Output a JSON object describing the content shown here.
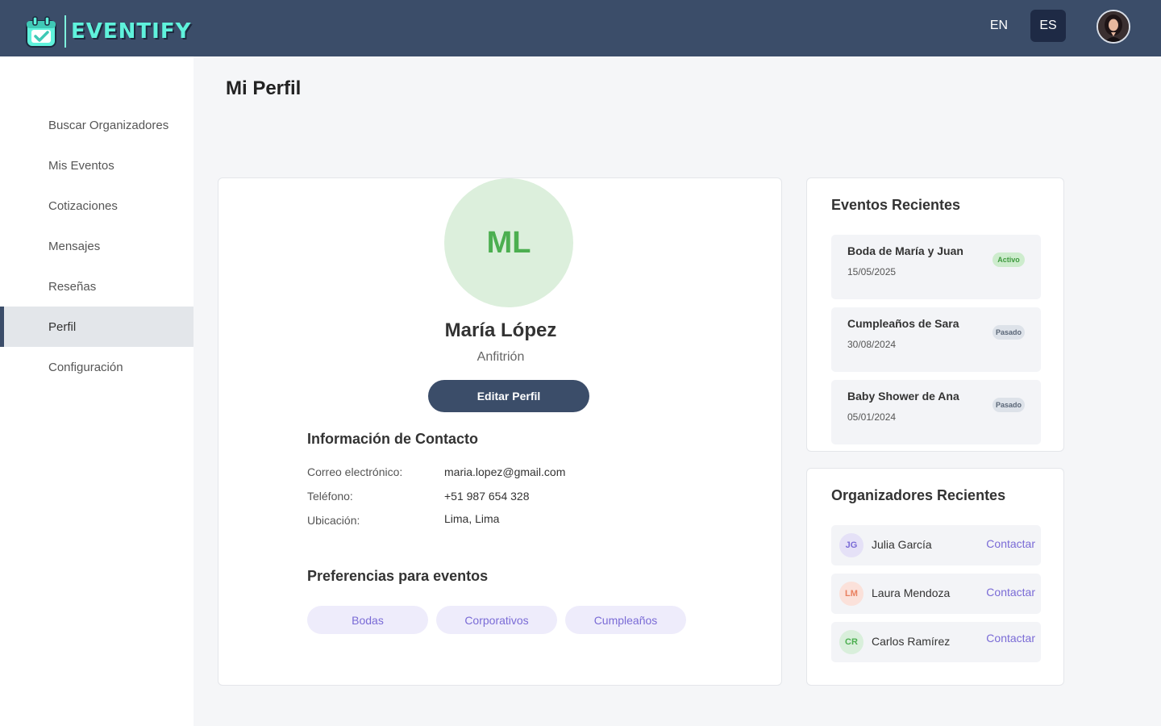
{
  "header": {
    "logo_text": "EVENTIFY",
    "languages": [
      {
        "label": "EN",
        "active": false
      },
      {
        "label": "ES",
        "active": true
      }
    ]
  },
  "sidebar": {
    "items": [
      {
        "label": "Buscar Organizadores",
        "active": false
      },
      {
        "label": "Mis Eventos",
        "active": false
      },
      {
        "label": "Cotizaciones",
        "active": false
      },
      {
        "label": "Mensajes",
        "active": false
      },
      {
        "label": "Reseñas",
        "active": false
      },
      {
        "label": "Perfil",
        "active": true
      },
      {
        "label": "Configuración",
        "active": false
      }
    ]
  },
  "page_title": "Mi Perfil",
  "profile": {
    "initials": "ML",
    "name": "María López",
    "role": "Anfitrión",
    "edit_label": "Editar Perfil",
    "contact_title": "Información de Contacto",
    "contact": {
      "email_label": "Correo electrónico:",
      "email": "maria.lopez@gmail.com",
      "phone_label": "Teléfono:",
      "phone": "+51 987 654 328",
      "location_label": "Ubicación:",
      "location": "Lima, Lima"
    },
    "preferences_title": "Preferencias para eventos",
    "preferences": [
      "Bodas",
      "Corporativos",
      "Cumpleaños"
    ]
  },
  "recent_events": {
    "title": "Eventos Recientes",
    "items": [
      {
        "name": "Boda de María y Juan",
        "date": "15/05/2025",
        "status": "Activo"
      },
      {
        "name": "Cumpleaños de Sara",
        "date": "30/08/2024",
        "status": "Pasado"
      },
      {
        "name": "Baby Shower de Ana",
        "date": "05/01/2024",
        "status": "Pasado"
      }
    ]
  },
  "recent_organizers": {
    "title": "Organizadores Recientes",
    "contact_label": "Contactar",
    "items": [
      {
        "initials": "JG",
        "name": "Julia García",
        "bg": "#e5e1f7",
        "fg": "#7a6bd6"
      },
      {
        "initials": "LM",
        "name": "Laura Mendoza",
        "bg": "#fbe1da",
        "fg": "#e98060"
      },
      {
        "initials": "CR",
        "name": "Carlos Ramírez",
        "bg": "#d9efdb",
        "fg": "#4caf50"
      }
    ]
  },
  "colors": {
    "header_bg": "#3b4d69",
    "accent": "#5ff2dc",
    "primary_button": "#3b4d69",
    "link": "#7a6bd6"
  }
}
